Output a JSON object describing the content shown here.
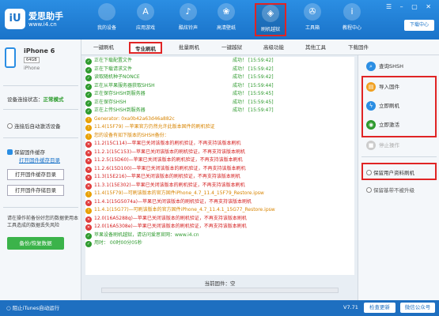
{
  "app": {
    "logo_cn": "爱思助手",
    "logo_url": "www.i4.cn",
    "logo_mark": "iU",
    "download_center": "下载中心",
    "window_controls": "☰ – ▢ ✕"
  },
  "nav": [
    {
      "label": "我的设备",
      "icon": "apple-icon",
      "glyph": ""
    },
    {
      "label": "应用游戏",
      "icon": "apps-icon",
      "glyph": "A"
    },
    {
      "label": "酷炫铃声",
      "icon": "bell-icon",
      "glyph": "♪"
    },
    {
      "label": "高清壁纸",
      "icon": "flower-icon",
      "glyph": "❀"
    },
    {
      "label": "刷机越狱",
      "icon": "box-icon",
      "glyph": "◈"
    },
    {
      "label": "工具箱",
      "icon": "wrench-icon",
      "glyph": "✇"
    },
    {
      "label": "教程中心",
      "icon": "info-icon",
      "glyph": "i"
    }
  ],
  "device": {
    "name": "iPhone 6",
    "capacity": "64GB",
    "model": "iPhone"
  },
  "left": {
    "mode_label": "设备连接状态：",
    "mode_value": "正常模式",
    "auto_activate": "连接后自动激活设备",
    "keep_firmware": "保留固件缓存",
    "firmware_dir_link": "打开固件缓存目录",
    "open_cache_btn": "打开固件缓存目录",
    "open_store_btn": "打开固件存储目录",
    "hint": "请在操作前备份好您的数据使用本工具造成的数据丢失风险",
    "backup_btn": "备份/恢复数据"
  },
  "tabs": [
    "一键刷机",
    "专业刷机",
    "批量刷机",
    "一键越狱",
    "高级功能",
    "其他工具",
    "下载固件"
  ],
  "log": [
    {
      "s": "ok",
      "t": "正在下载配置文件",
      "r": "成功！ [15:59:42]"
    },
    {
      "s": "ok",
      "t": "正在下载请求文件",
      "r": "成功！ [15:59:42]"
    },
    {
      "s": "ok",
      "t": "读取随机种子NONCE",
      "r": "成功！ [15:59:42]"
    },
    {
      "s": "ok",
      "t": "正在从苹果服务器获取SHSH",
      "r": "成功！ [15:59:44]"
    },
    {
      "s": "ok",
      "t": "正在保存SHSH到服务器",
      "r": "成功！ [15:59:45]"
    },
    {
      "s": "ok",
      "t": "正在保存SHSH",
      "r": "成功！ [15:59:45]"
    },
    {
      "s": "ok",
      "t": "正在上传SHSH到服务器",
      "r": "成功！ [15:59:47]"
    },
    {
      "s": "warn",
      "t": "Generator: 0xa0b42a63d46a882c",
      "r": ""
    },
    {
      "s": "warn",
      "t": "11.4(15F79) —苹果官方仍然允许此版本固件的刷机验证",
      "r": ""
    },
    {
      "s": "warn",
      "t": "您的设备有如下版本的SHSH备份：",
      "r": ""
    },
    {
      "s": "err",
      "t": "11.2(15C114)—苹果已关闭该版本的刷机验证，不再支持该版本刷机",
      "r": ""
    },
    {
      "s": "err",
      "t": "11.2.1(15C153)—苹果已关闭该版本的刷机验证，不再支持该版本刷机",
      "r": ""
    },
    {
      "s": "err",
      "t": "11.2.5(15D60)—苹果已关闭该版本的刷机验证，不再支持该版本刷机",
      "r": ""
    },
    {
      "s": "err",
      "t": "11.2.6(15D100)—苹果已关闭该版本的刷机验证，不再支持该版本刷机",
      "r": ""
    },
    {
      "s": "err",
      "t": "11.3(15E216)—苹果已关闭该版本的刷机验证，不再支持该版本刷机",
      "r": ""
    },
    {
      "s": "err",
      "t": "11.3.1(15E302)—苹果已关闭该版本的刷机验证，不再支持该版本刷机",
      "r": ""
    },
    {
      "s": "warn",
      "t": "11.4(15F79)—可刷该版本的官方固件iPhone_4.7_11.4_15F79_Restore.ipsw",
      "r": ""
    },
    {
      "s": "err",
      "t": "11.4.1(15G5074a)—苹果已关闭该版本的刷机验证，不再支持该版本刷机",
      "r": ""
    },
    {
      "s": "warn",
      "t": "11.4.1(15G77)—可刷该版本的官方固件iPhone_4.7_11.4.1_15G77_Restore.ipsw",
      "r": ""
    },
    {
      "s": "err",
      "t": "12.0(16A5288q)—苹果已关闭该版本的刷机验证，不再支持该版本刷机",
      "r": ""
    },
    {
      "s": "err",
      "t": "12.0(16A5308e)—苹果已关闭该版本的刷机验证，不再支持该版本刷机",
      "r": ""
    },
    {
      "s": "ok",
      "t": "苹果设备刷机越狱，请访问爱思官网：www.i4.cn",
      "r": ""
    },
    {
      "s": "ok",
      "t": "用时： 00时00分05秒",
      "r": ""
    }
  ],
  "current_firmware": "当前固件：空",
  "progress": 0,
  "right": {
    "query_shsh": "查询SHSH",
    "import_firmware": "导入固件",
    "flash_now": "立即刷机",
    "activate_now": "立即激活",
    "stop": "停止操作",
    "keep_data": "保留用户资料刷机",
    "anti_downgrade": "保留基带不被升级"
  },
  "bottom": {
    "itunes": "阻止iTunes自动运行",
    "version": "V7.71",
    "check_update": "检查更新",
    "wechat": "微信公众号"
  },
  "colors": {
    "primary": "#1a73c9",
    "success": "#2e9a2e",
    "warning": "#d88400",
    "error": "#d42020",
    "highlight": "#e02424"
  }
}
